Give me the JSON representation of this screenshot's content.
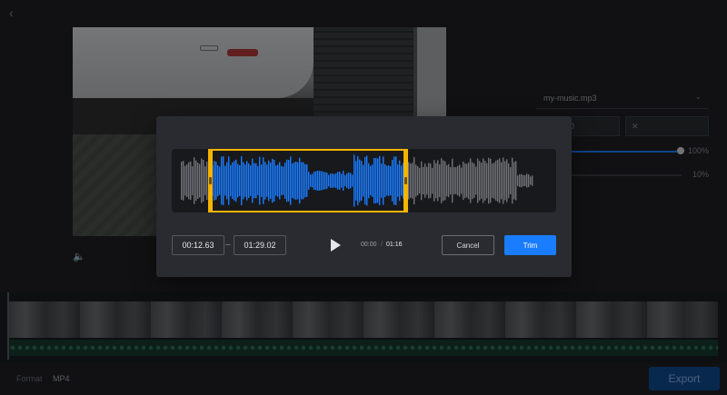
{
  "background": {
    "right_panel": {
      "audio_file": "my-music.mp3",
      "start_time": "00:00:00",
      "volume_value": "100%",
      "fade_value": "10%"
    },
    "footer": {
      "format_label": "Format",
      "format_value": "MP4",
      "export_label": "Export"
    }
  },
  "trim_dialog": {
    "start_time": "00:12.63",
    "end_time": "01:29.02",
    "separator": "–",
    "current_time": "00:00",
    "time_divider": "/",
    "duration": "01:16",
    "cancel_label": "Cancel",
    "trim_label": "Trim",
    "selection_fraction": [
      0.09,
      0.61
    ]
  },
  "colors": {
    "accent": "#1a7cff",
    "selection_handle": "#f5b400",
    "waveform_selected": "#1a7cff",
    "waveform_unselected": "#6f7176"
  }
}
